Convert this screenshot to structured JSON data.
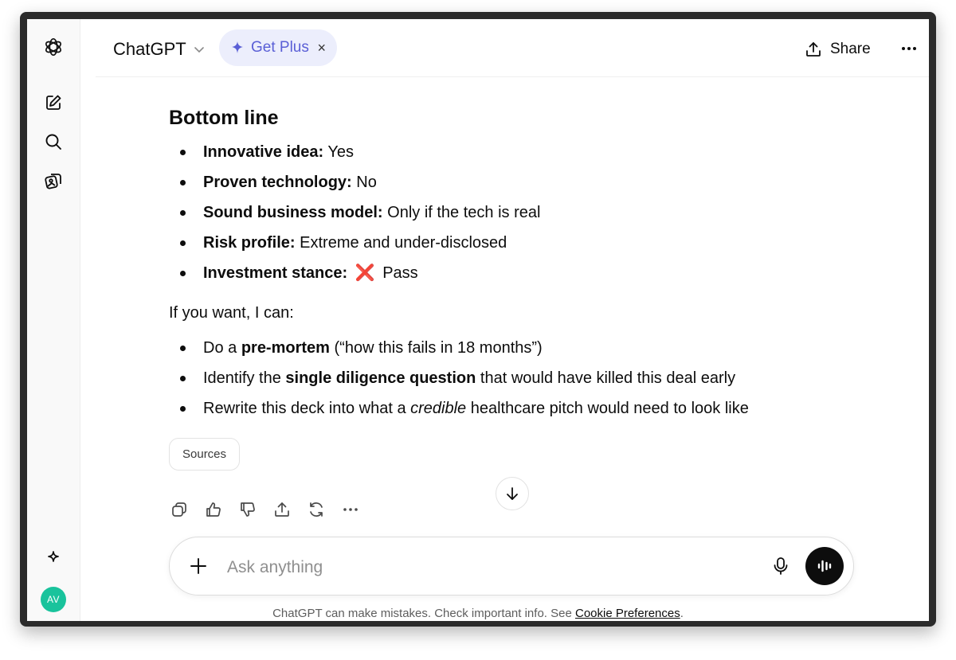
{
  "app": {
    "model_name": "ChatGPT"
  },
  "header": {
    "get_plus_label": "Get Plus",
    "close_symbol": "×",
    "share_label": "Share"
  },
  "sidebar": {
    "icons": [
      "openai-logo-icon",
      "new-chat-icon",
      "search-icon",
      "library-icon",
      "sparkle-icon"
    ],
    "avatar_initials": "AV",
    "avatar_color": "#19c39c"
  },
  "message": {
    "heading": "Bottom line",
    "summary": [
      {
        "label": "Innovative idea:",
        "value": "Yes"
      },
      {
        "label": "Proven technology:",
        "value": "No"
      },
      {
        "label": "Sound business model:",
        "value": "Only if the tech is real"
      },
      {
        "label": "Risk profile:",
        "value": "Extreme and under-disclosed"
      },
      {
        "label": "Investment stance:",
        "emoji": "❌",
        "value": "Pass"
      }
    ],
    "intro": "If you want, I can:",
    "offers": [
      {
        "pre": "Do a ",
        "bold": "pre-mortem",
        "post": " (“how this fails in 18 months”)"
      },
      {
        "pre": "Identify the ",
        "bold": "single diligence question",
        "post": " that would have killed this deal early"
      },
      {
        "pre": "Rewrite this deck into what a ",
        "italic": "credible",
        "post": " healthcare pitch would need to look like"
      }
    ],
    "sources_label": "Sources"
  },
  "composer": {
    "placeholder": "Ask anything"
  },
  "footer": {
    "disclaimer_text": "ChatGPT can make mistakes. Check important info. See ",
    "link_label": "Cookie Preferences",
    "disclaimer_end": "."
  },
  "colors": {
    "accent": "#5a5fd6",
    "get_plus_bg": "#eceefc",
    "cross_emoji": "#e8456b"
  }
}
